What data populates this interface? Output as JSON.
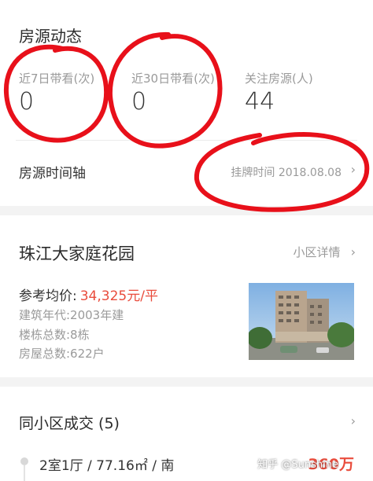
{
  "section_house": {
    "title": "房源动态",
    "stats": [
      {
        "label": "近7日带看(次)",
        "value": "0"
      },
      {
        "label": "近30日带看(次)",
        "value": "0"
      },
      {
        "label": "关注房源(人)",
        "value": "44"
      }
    ]
  },
  "timeline": {
    "label": "房源时间轴",
    "right_text": "挂牌时间 2018.08.08",
    "chevron": "›"
  },
  "community": {
    "name": "珠江大家庭花园",
    "detail_link": "小区详情",
    "chevron": "›",
    "price_label": "参考均价:",
    "price_value": "34,325元/平",
    "built_year": "建筑年代:2003年建",
    "building_count": "楼栋总数:8栋",
    "house_count": "房屋总数:622户",
    "photo_icon": "building-photo"
  },
  "deals": {
    "title": "同小区成交 (5)",
    "chevron": "›",
    "first_row": "2室1厅 / 77.16㎡ / 南",
    "first_price": "360万"
  },
  "watermark": "知乎 @Sunshine",
  "colors": {
    "accent_price": "#e94c3c",
    "annotation_red": "#e8101a"
  }
}
